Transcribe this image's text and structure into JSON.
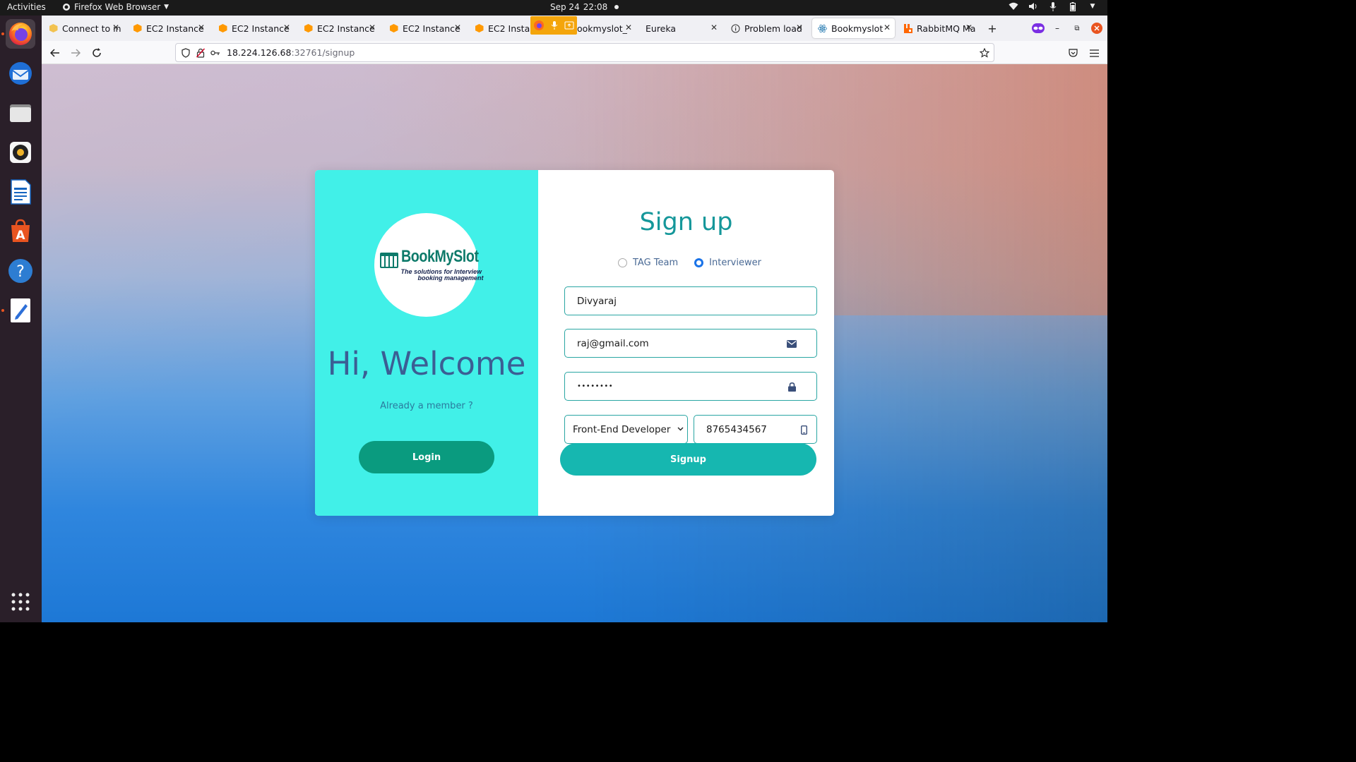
{
  "system_bar": {
    "activities": "Activities",
    "app_name": "Firefox Web Browser",
    "date": "Sep 24",
    "time": "22:08"
  },
  "dock": {
    "items": [
      "firefox-icon",
      "thunderbird-icon",
      "files-icon",
      "rhythmbox-icon",
      "writer-icon",
      "software-icon",
      "help-icon",
      "text-editor-icon",
      "app-grid-icon"
    ]
  },
  "browser": {
    "tabs": [
      {
        "label": "Connect to in",
        "icon": "aws-icon"
      },
      {
        "label": "EC2 Instance",
        "icon": "aws-icon"
      },
      {
        "label": "EC2 Instance",
        "icon": "aws-icon"
      },
      {
        "label": "EC2 Instance",
        "icon": "aws-icon"
      },
      {
        "label": "EC2 Instance",
        "icon": "aws-icon"
      },
      {
        "label": "EC2 Instanc",
        "icon": "aws-icon"
      },
      {
        "label": "ookmyslot_",
        "icon": "none"
      },
      {
        "label": "Eureka",
        "icon": "none"
      },
      {
        "label": "Problem load",
        "icon": "info-icon"
      },
      {
        "label": "Bookmyslot",
        "icon": "react-icon",
        "selected": true
      },
      {
        "label": "RabbitMQ Ma",
        "icon": "rabbitmq-icon"
      }
    ],
    "url": {
      "host": "18.224.126.68",
      "rest": ":32761/signup"
    }
  },
  "welcome_panel": {
    "logo": {
      "brand": "BookMySlot",
      "tagline_line1": "The solutions for Interview",
      "tagline_line2": "booking management"
    },
    "heading": "Hi, Welcome",
    "member_text": "Already a member ?",
    "login_label": "Login"
  },
  "signup_form": {
    "title": "Sign up",
    "roles": [
      {
        "label": "TAG Team",
        "selected": false
      },
      {
        "label": "Interviewer",
        "selected": true
      }
    ],
    "name_value": "Divyaraj",
    "email_value": "raj@gmail.com",
    "password_value": "••••••••",
    "role_select_value": "Front-End Developer",
    "phone_value": "8765434567",
    "signup_label": "Signup"
  },
  "colors": {
    "left_panel": "#41f0e8",
    "login_button": "#0a9b7f",
    "signup_button": "#16b7b0",
    "title_text": "#15979a",
    "welcome_text": "#3b5e94"
  }
}
